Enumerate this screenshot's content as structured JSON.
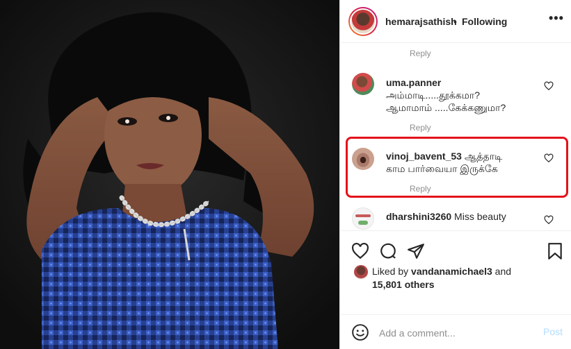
{
  "post": {
    "username": "hemarajsathish",
    "dot": "•",
    "following_label": "Following",
    "more_label": "•••"
  },
  "comments": {
    "top_reply": "Reply",
    "items": [
      {
        "username": "uma.panner",
        "text_line1": "அம்மாடி.....தூக்கமா?",
        "text_line2": "ஆமாமாம் .....கேக்கணுமா?",
        "reply": "Reply"
      },
      {
        "username": "vinoj_bavent_53",
        "text_line1": "ஆத்தாடி",
        "text_line2": "காம பார்வையா இருக்கே",
        "reply": "Reply"
      },
      {
        "username": "dharshini3260",
        "text_line1": "Miss beauty"
      }
    ]
  },
  "likes": {
    "liked_by_prefix": "Liked by",
    "liked_by_user": "vandanamichael3",
    "and_label": "and",
    "others": "15,801 others"
  },
  "add_comment": {
    "placeholder": "Add a comment...",
    "post_label": "Post"
  },
  "icons": {
    "more": "more-options-icon",
    "heart": "heart-icon",
    "comment": "comment-icon",
    "share": "share-icon",
    "save": "bookmark-icon",
    "emoji": "emoji-icon"
  },
  "colors": {
    "highlight": "#e3121b",
    "post_button": "#b3dbff",
    "muted": "#8e8e8e"
  }
}
